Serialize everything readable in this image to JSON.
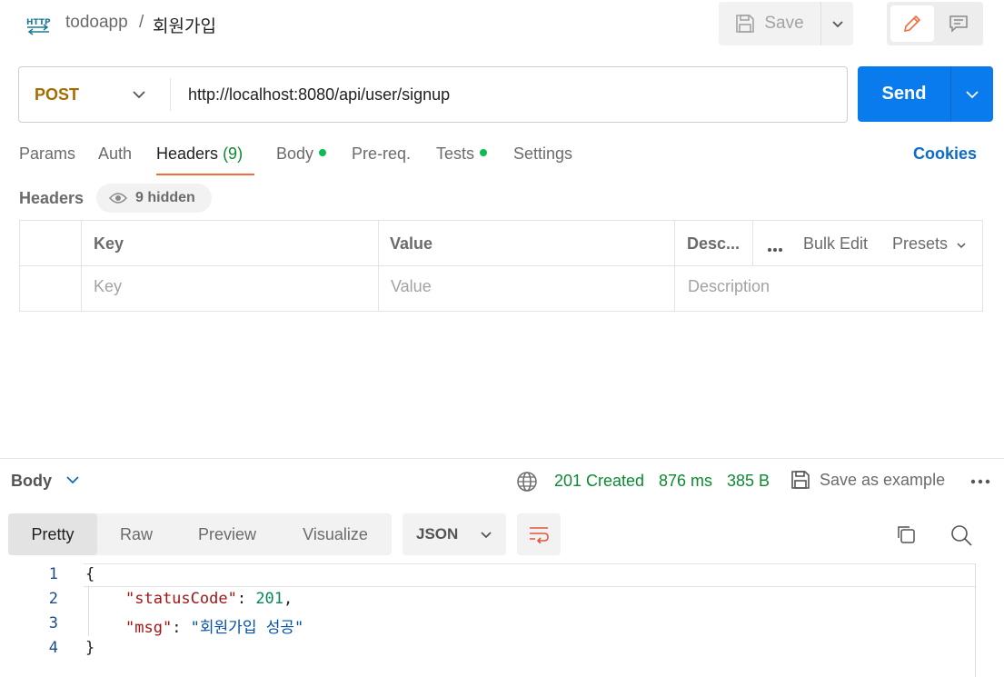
{
  "breadcrumb": {
    "collection": "todoapp",
    "separator": "/",
    "request": "회원가입"
  },
  "toolbar": {
    "save_label": "Save"
  },
  "request": {
    "method": "POST",
    "url": "http://localhost:8080/api/user/signup",
    "send_label": "Send"
  },
  "tabs": [
    {
      "label": "Params"
    },
    {
      "label": "Auth"
    },
    {
      "label": "Headers",
      "count": "(9)",
      "active": true
    },
    {
      "label": "Body",
      "has_dot": true
    },
    {
      "label": "Pre-req."
    },
    {
      "label": "Tests",
      "has_dot": true
    },
    {
      "label": "Settings"
    }
  ],
  "cookies_label": "Cookies",
  "headers_section": {
    "title": "Headers",
    "hidden_label": "9 hidden"
  },
  "headers_table": {
    "columns": [
      "Key",
      "Value",
      "Desc..."
    ],
    "actions": {
      "bulk_edit": "Bulk Edit",
      "presets": "Presets"
    },
    "placeholders": {
      "key": "Key",
      "value": "Value",
      "description": "Description"
    }
  },
  "response": {
    "body_label": "Body",
    "status": "201 Created",
    "time": "876 ms",
    "size": "385 B",
    "save_example": "Save as example",
    "view_tabs": [
      "Pretty",
      "Raw",
      "Preview",
      "Visualize"
    ],
    "active_view": "Pretty",
    "format": "JSON",
    "lines": [
      "1",
      "2",
      "3",
      "4"
    ],
    "json": {
      "open": "{",
      "key1": "\"statusCode\"",
      "val1": "201",
      "key2": "\"msg\"",
      "val2": "\"회원가입 성공\"",
      "close": "}"
    }
  },
  "colors": {
    "accent": "#097bed",
    "method": "#a86b00",
    "status_ok": "#0c8a31",
    "active_tab_underline": "#f26b3a"
  }
}
